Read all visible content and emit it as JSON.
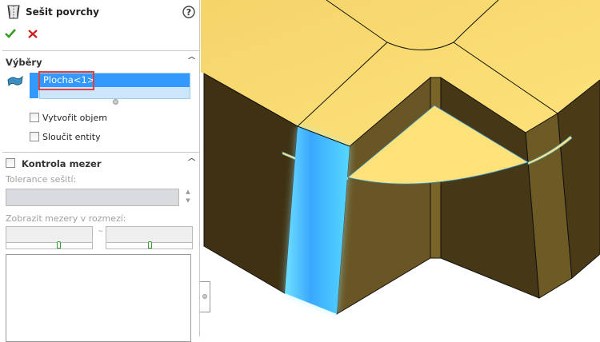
{
  "panel": {
    "title": "Sešit povrchy",
    "icons": {
      "feature": "surface-knit-icon",
      "help": "help-icon",
      "ok": "checkmark-icon",
      "cancel": "close-icon"
    },
    "ok_color": "#3a9a2a",
    "cancel_color": "#d0201a",
    "selections": {
      "header": "Výběry",
      "items": [
        "Plocha<1>"
      ],
      "create_solid_label": "Vytvořit objem",
      "merge_entities_label": "Sloučit entity",
      "create_solid_checked": false,
      "merge_entities_checked": false
    },
    "gap_control": {
      "header": "Kontrola mezer",
      "checked": false,
      "tolerance_label": "Tolerance sešití:",
      "tolerance_value": "",
      "range_label": "Zobrazit mezery v rozmezí:",
      "range_min": "",
      "range_max": "",
      "range_separator": "~"
    }
  },
  "viewport": {
    "model_color": "#f7d56a",
    "side_color": "#4a3b16",
    "selection_color": "#3aa8ff"
  }
}
